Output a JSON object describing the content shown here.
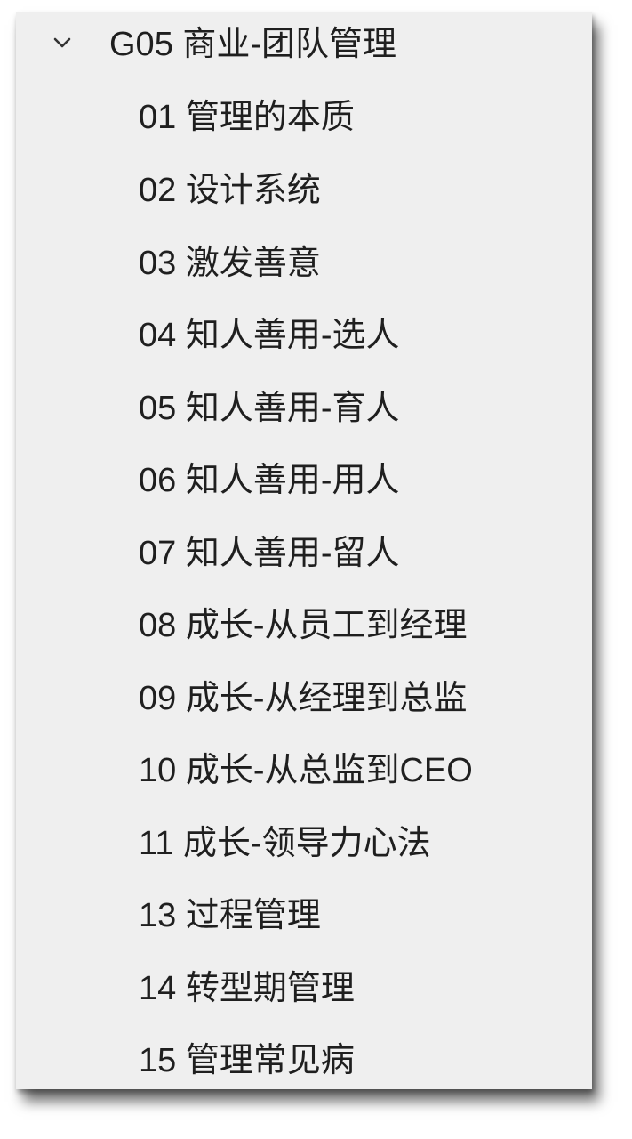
{
  "tree": {
    "group": {
      "icon": "chevron-down-icon",
      "title": "G05 商业-团队管理"
    },
    "items": [
      {
        "label": "01 管理的本质"
      },
      {
        "label": "02 设计系统"
      },
      {
        "label": "03 激发善意"
      },
      {
        "label": "04 知人善用-选人"
      },
      {
        "label": "05 知人善用-育人"
      },
      {
        "label": "06 知人善用-用人"
      },
      {
        "label": "07 知人善用-留人"
      },
      {
        "label": "08 成长-从员工到经理"
      },
      {
        "label": "09 成长-从经理到总监"
      },
      {
        "label": "10 成长-从总监到CEO"
      },
      {
        "label": "11 成长-领导力心法"
      },
      {
        "label": "13 过程管理"
      },
      {
        "label": "14 转型期管理"
      },
      {
        "label": "15 管理常见病"
      }
    ]
  }
}
